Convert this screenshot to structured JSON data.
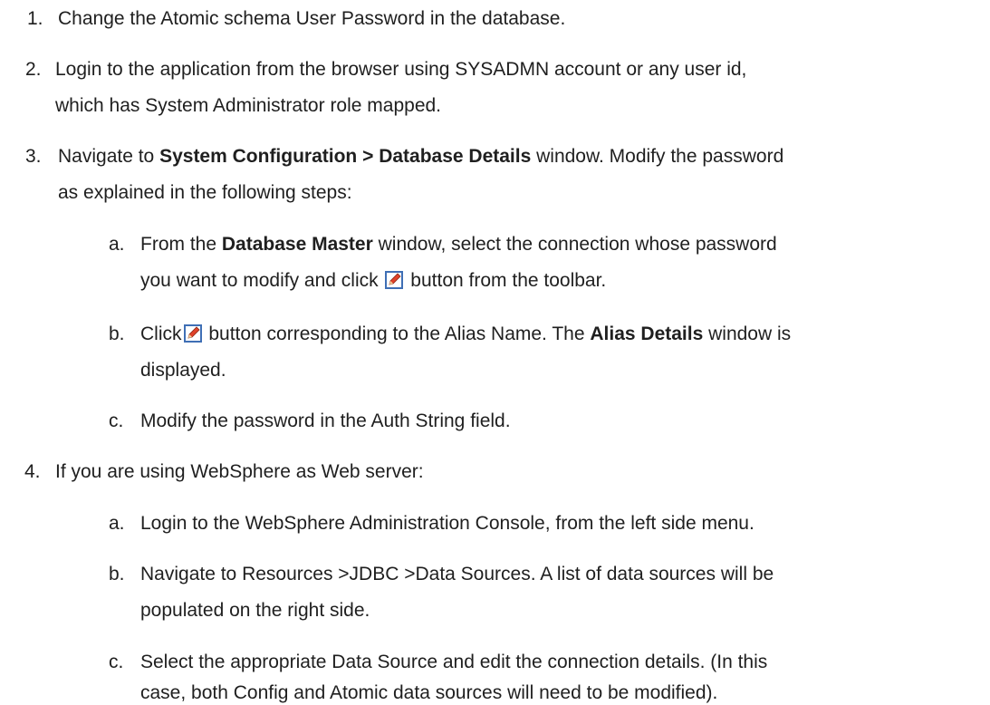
{
  "steps": [
    {
      "number": "1.",
      "text": "Change the Atomic schema User Password in the database."
    },
    {
      "number": "2.",
      "line1": "Login to the application from the browser using SYSADMN account or any user id,",
      "line2": "which has System Administrator role mapped."
    },
    {
      "number": "3.",
      "line1_pre": "Navigate to ",
      "line1_bold": "System Configuration > Database Details",
      "line1_post": " window. Modify the password",
      "line2": "as explained in the following steps:",
      "substeps": [
        {
          "letter": "a.",
          "line1_pre": "From the ",
          "line1_bold": "Database Master",
          "line1_post": " window, select the connection whose password",
          "line2_pre": "you want to modify and click ",
          "line2_post": " button from the toolbar.",
          "icon": "edit-icon"
        },
        {
          "letter": "b.",
          "line1_pre": "Click",
          "line1_mid": " button corresponding to the Alias Name. The ",
          "line1_bold": "Alias Details",
          "line1_post": " window is",
          "line2": "displayed.",
          "icon": "edit-icon"
        },
        {
          "letter": "c.",
          "text": "Modify the password in the Auth String field."
        }
      ]
    },
    {
      "number": "4.",
      "text": "If you are using WebSphere as Web server:",
      "substeps": [
        {
          "letter": "a.",
          "text": "Login to the WebSphere Administration Console, from the left side menu."
        },
        {
          "letter": "b.",
          "line1": "Navigate to Resources >JDBC >Data Sources. A list of data sources will be",
          "line2": "populated on the right side."
        },
        {
          "letter": "c.",
          "line1": "Select the appropriate Data Source and edit the connection details. (In this",
          "line2": "case, both Config and Atomic data sources will need to be modified)."
        }
      ]
    }
  ],
  "colors": {
    "text": "#1f1f1f",
    "icon_border": "#3f6fb5",
    "icon_pencil": "#e0422a"
  }
}
